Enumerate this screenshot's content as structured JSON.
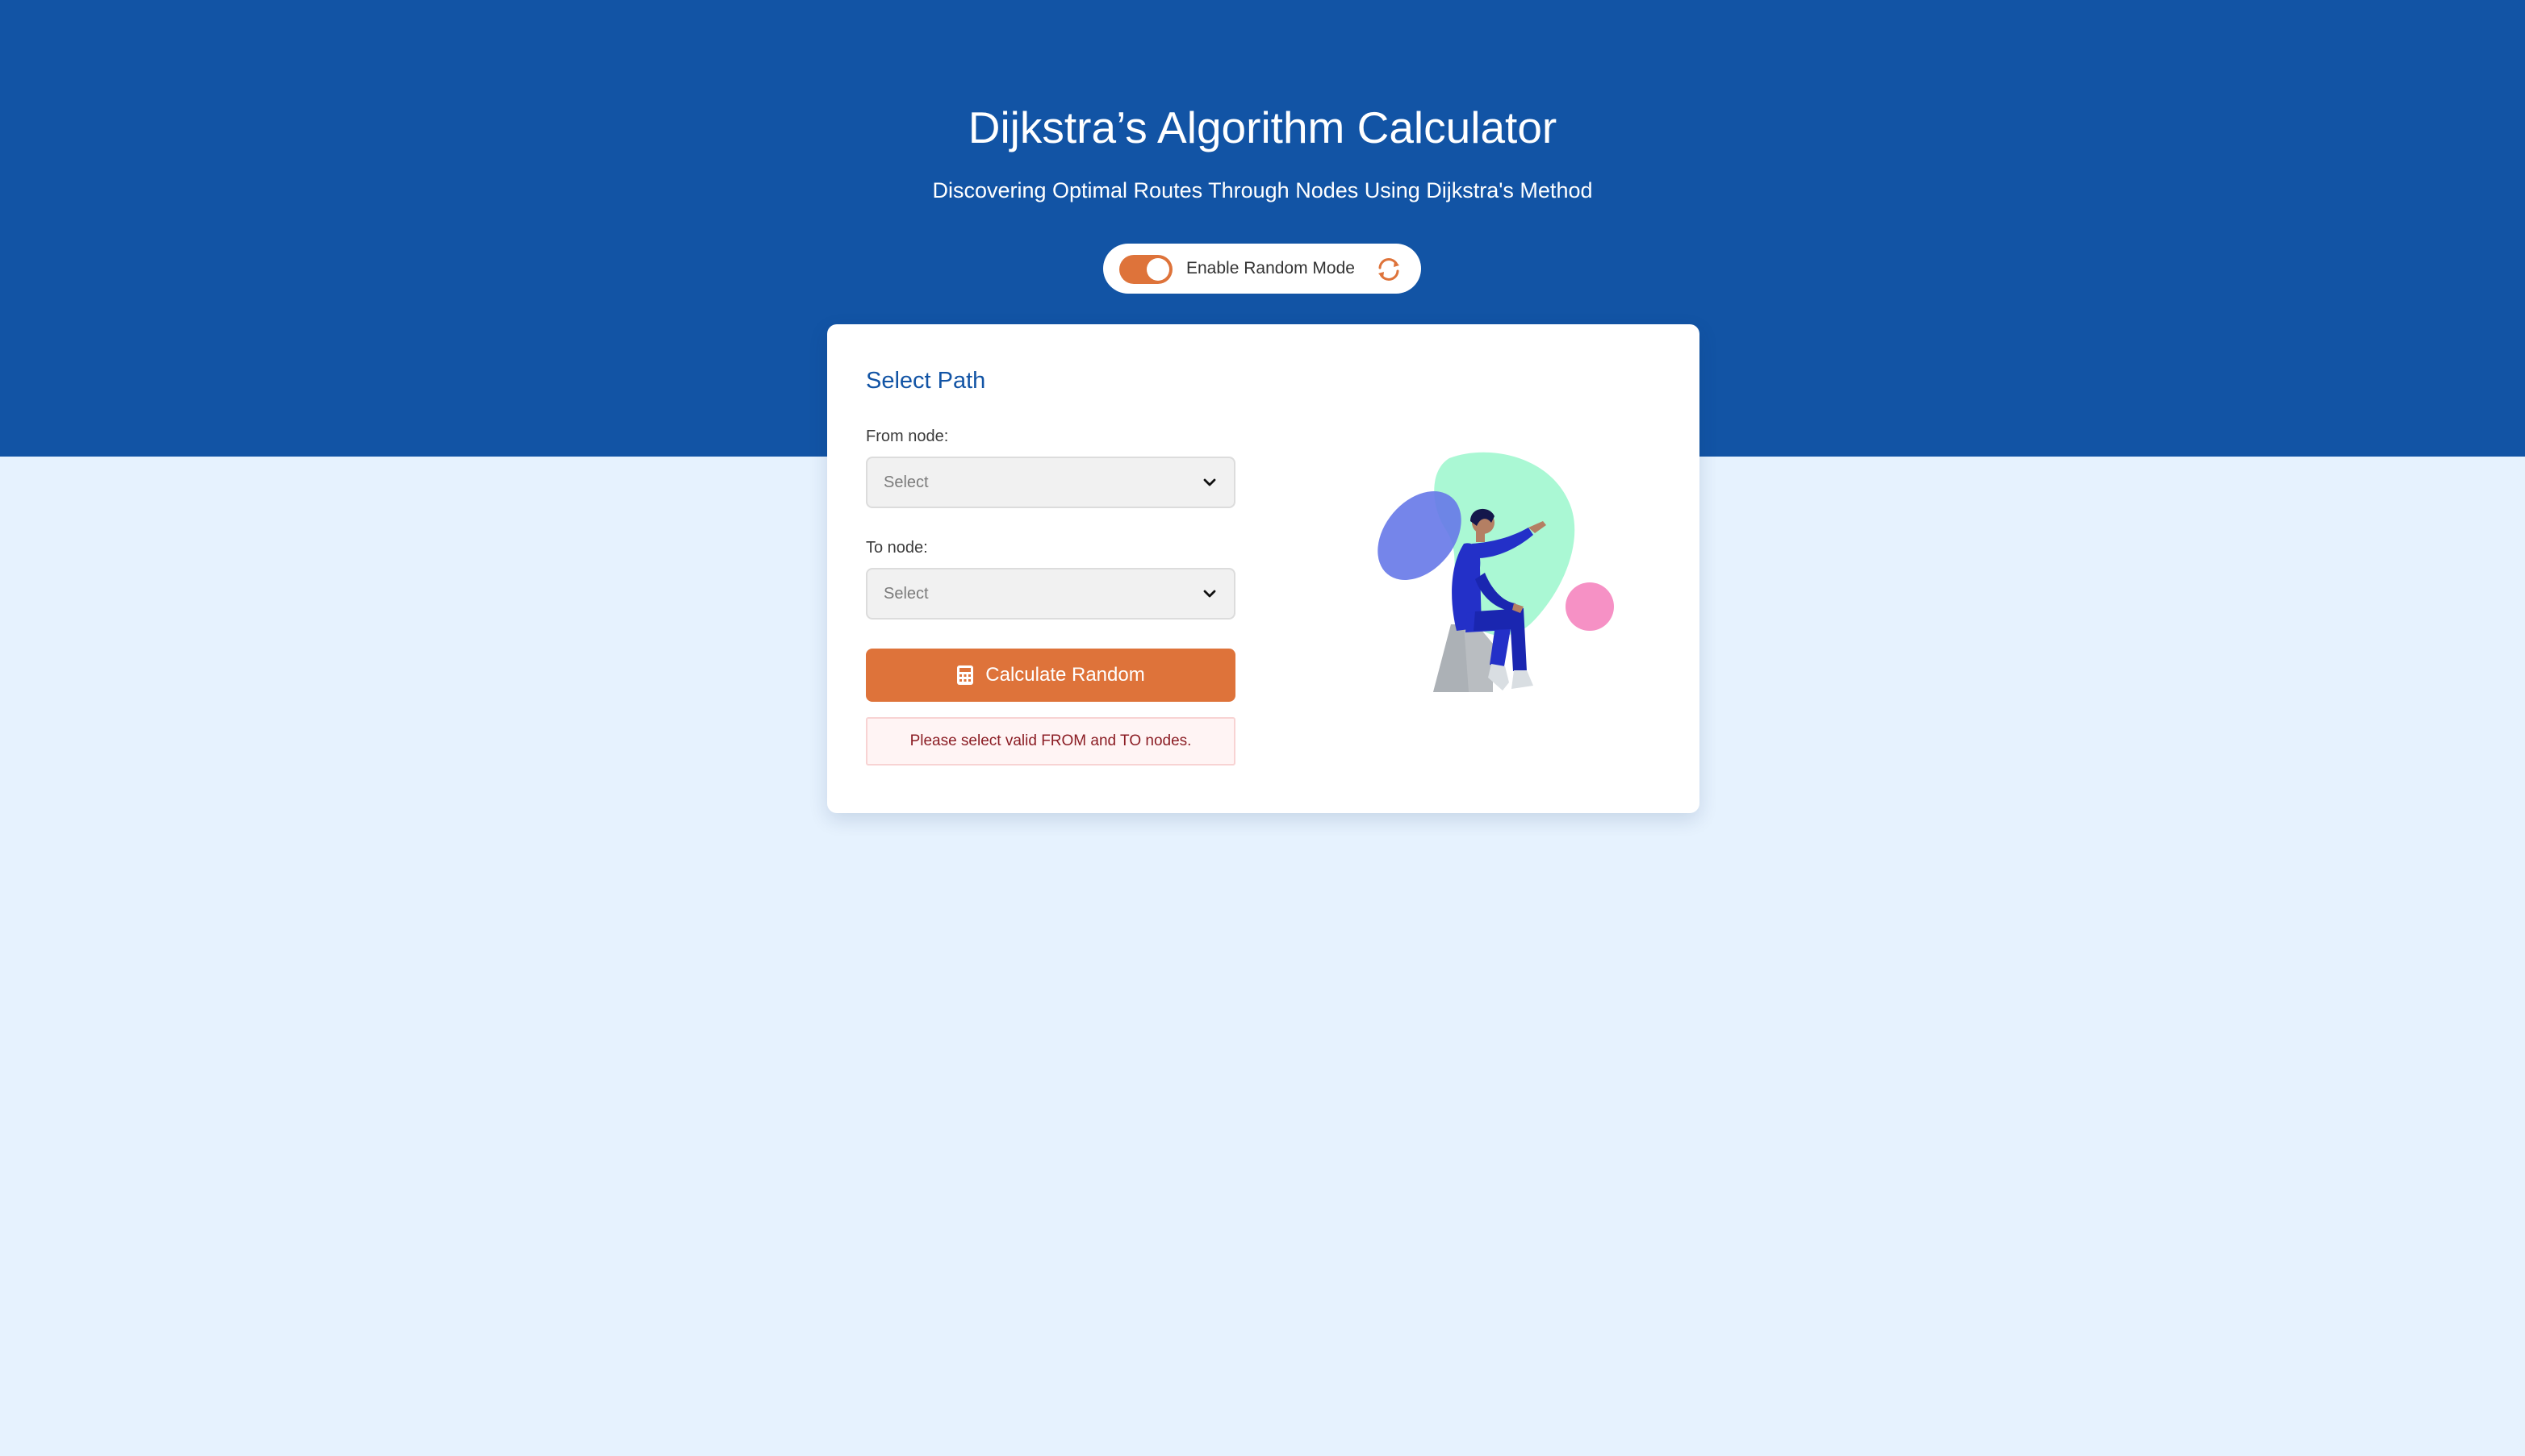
{
  "header": {
    "title": "Dijkstra’s Algorithm Calculator",
    "subtitle": "Discovering Optimal Routes Through Nodes Using Dijkstra's Method"
  },
  "random_mode": {
    "label": "Enable Random Mode",
    "enabled": true,
    "refresh_icon": "refresh-icon"
  },
  "card": {
    "title": "Select Path",
    "from_node": {
      "label": "From node:",
      "value": "Select"
    },
    "to_node": {
      "label": "To node:",
      "value": "Select"
    },
    "calculate_button": {
      "label": "Calculate Random",
      "icon": "calculator-icon"
    },
    "error_message": "Please select valid FROM and TO nodes.",
    "illustration": "person-pointing-illustration"
  },
  "colors": {
    "header_background": "#1254a5",
    "page_background": "#e6f2fe",
    "accent_orange": "#de733a",
    "error_text": "#8b1d24",
    "error_background": "#fff4f4"
  }
}
